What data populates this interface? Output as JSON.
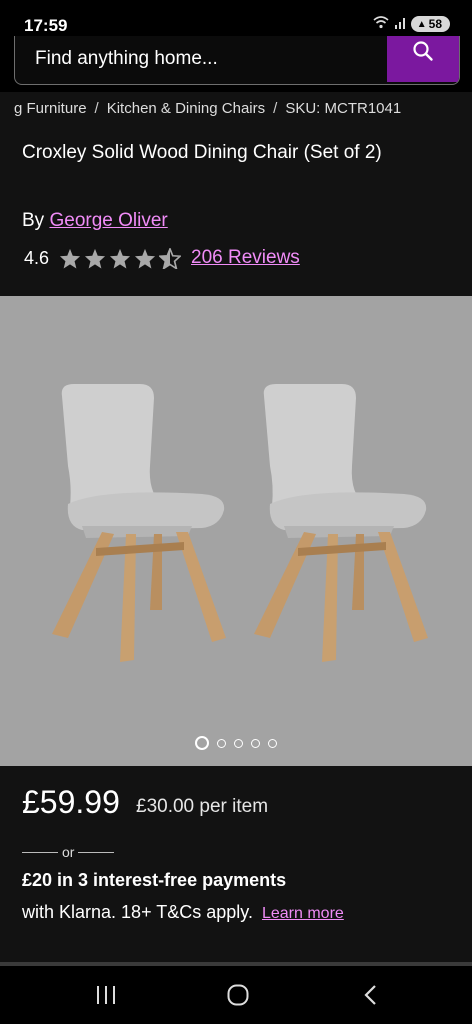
{
  "status": {
    "time": "17:59",
    "battery": "58"
  },
  "search": {
    "placeholder": "Find anything home..."
  },
  "breadcrumb": [
    "g Furniture",
    "Kitchen & Dining Chairs",
    "SKU: MCTR1041"
  ],
  "product": {
    "title": "Croxley Solid Wood Dining Chair (Set of 2)",
    "brand_prefix": "By",
    "brand": "George Oliver",
    "rating": "4.6",
    "stars": 4.5,
    "reviews": "206 Reviews"
  },
  "gallery": {
    "image_count": 5,
    "active_index": 0
  },
  "pricing": {
    "price": "£59.99",
    "per_item": "£30.00 per item",
    "or": "or",
    "klarna_bold": "£20 in 3 interest-free payments",
    "klarna_text": "with Klarna. 18+ T&Cs apply.",
    "learn_more": "Learn more"
  },
  "colors": {
    "accent": "#7b189f",
    "link": "#f08cf7",
    "background": "#121212"
  }
}
